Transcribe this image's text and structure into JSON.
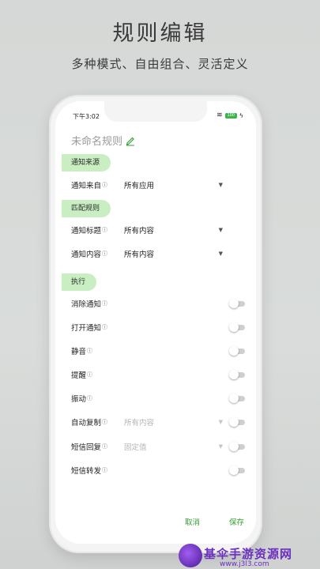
{
  "promo": {
    "title": "规则编辑",
    "subtitle": "多种模式、自由组合、灵活定义"
  },
  "status_bar": {
    "time": "下午3:02",
    "battery": "100"
  },
  "rule": {
    "name": "未命名规则"
  },
  "sections": {
    "source": "通知来源",
    "match": "匹配规则",
    "execute": "执行"
  },
  "source_rows": {
    "notify_from": {
      "label": "通知来自",
      "value": "所有应用"
    }
  },
  "match_rows": {
    "title": {
      "label": "通知标题",
      "value": "所有内容"
    },
    "content": {
      "label": "通知内容",
      "value": "所有内容"
    }
  },
  "actions": {
    "clear_notification": {
      "label": "消除通知",
      "enabled": false
    },
    "open_notification": {
      "label": "打开通知",
      "enabled": false
    },
    "mute": {
      "label": "静音",
      "enabled": false
    },
    "remind": {
      "label": "提醒",
      "enabled": false
    },
    "vibrate": {
      "label": "振动",
      "enabled": false
    },
    "auto_copy": {
      "label": "自动复制",
      "value": "所有内容",
      "enabled": false
    },
    "sms_reply": {
      "label": "短信回复",
      "value": "固定值",
      "enabled": false
    },
    "sms_forward": {
      "label": "短信转发",
      "enabled": false
    }
  },
  "footer": {
    "cancel": "取消",
    "save": "保存"
  },
  "watermark": {
    "brand": "基伞手游资源网",
    "url": "www.j3l3.com"
  },
  "colors": {
    "accent": "#3a9f3a",
    "section_bg": "#c9eec2"
  },
  "icons": {
    "info": "ⓘ",
    "dropdown": "▼"
  }
}
